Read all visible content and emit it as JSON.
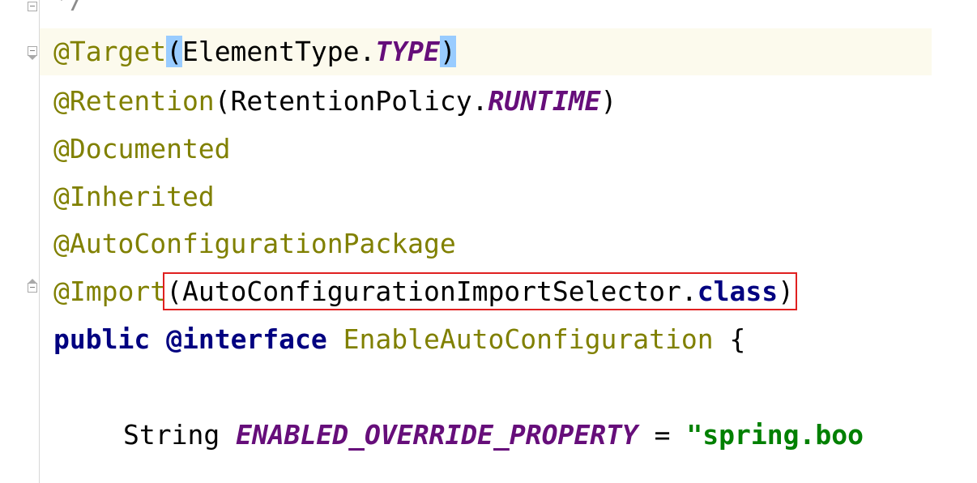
{
  "editor": {
    "lines": {
      "comment_end": "*/",
      "target": {
        "annotation": "@Target",
        "open": "(",
        "type": "ElementType.",
        "constant": "TYPE",
        "close": ")"
      },
      "retention": {
        "annotation": "@Retention",
        "open": "(",
        "type": "RetentionPolicy.",
        "constant": "RUNTIME",
        "close": ")"
      },
      "documented": "@Documented",
      "inherited": "@Inherited",
      "auto_config_package": "@AutoConfigurationPackage",
      "import": {
        "annotation": "@Import",
        "open": "(",
        "selector": "AutoConfigurationImportSelector.",
        "keyword": "class",
        "close": ")"
      },
      "declaration": {
        "public": "public",
        "interface": "@interface",
        "name": "EnableAutoConfiguration",
        "brace": "{"
      },
      "field": {
        "type": "String",
        "constant": "ENABLED_OVERRIDE_PROPERTY",
        "equals": "=",
        "string": "\"spring.boo"
      }
    },
    "colors": {
      "annotation": "#808000",
      "keyword": "#000080",
      "constant": "#660e7a",
      "string": "#008000",
      "current_line": "#fcfaed",
      "bracket_match": "#99ccff",
      "highlight_box": "#e02020"
    }
  }
}
